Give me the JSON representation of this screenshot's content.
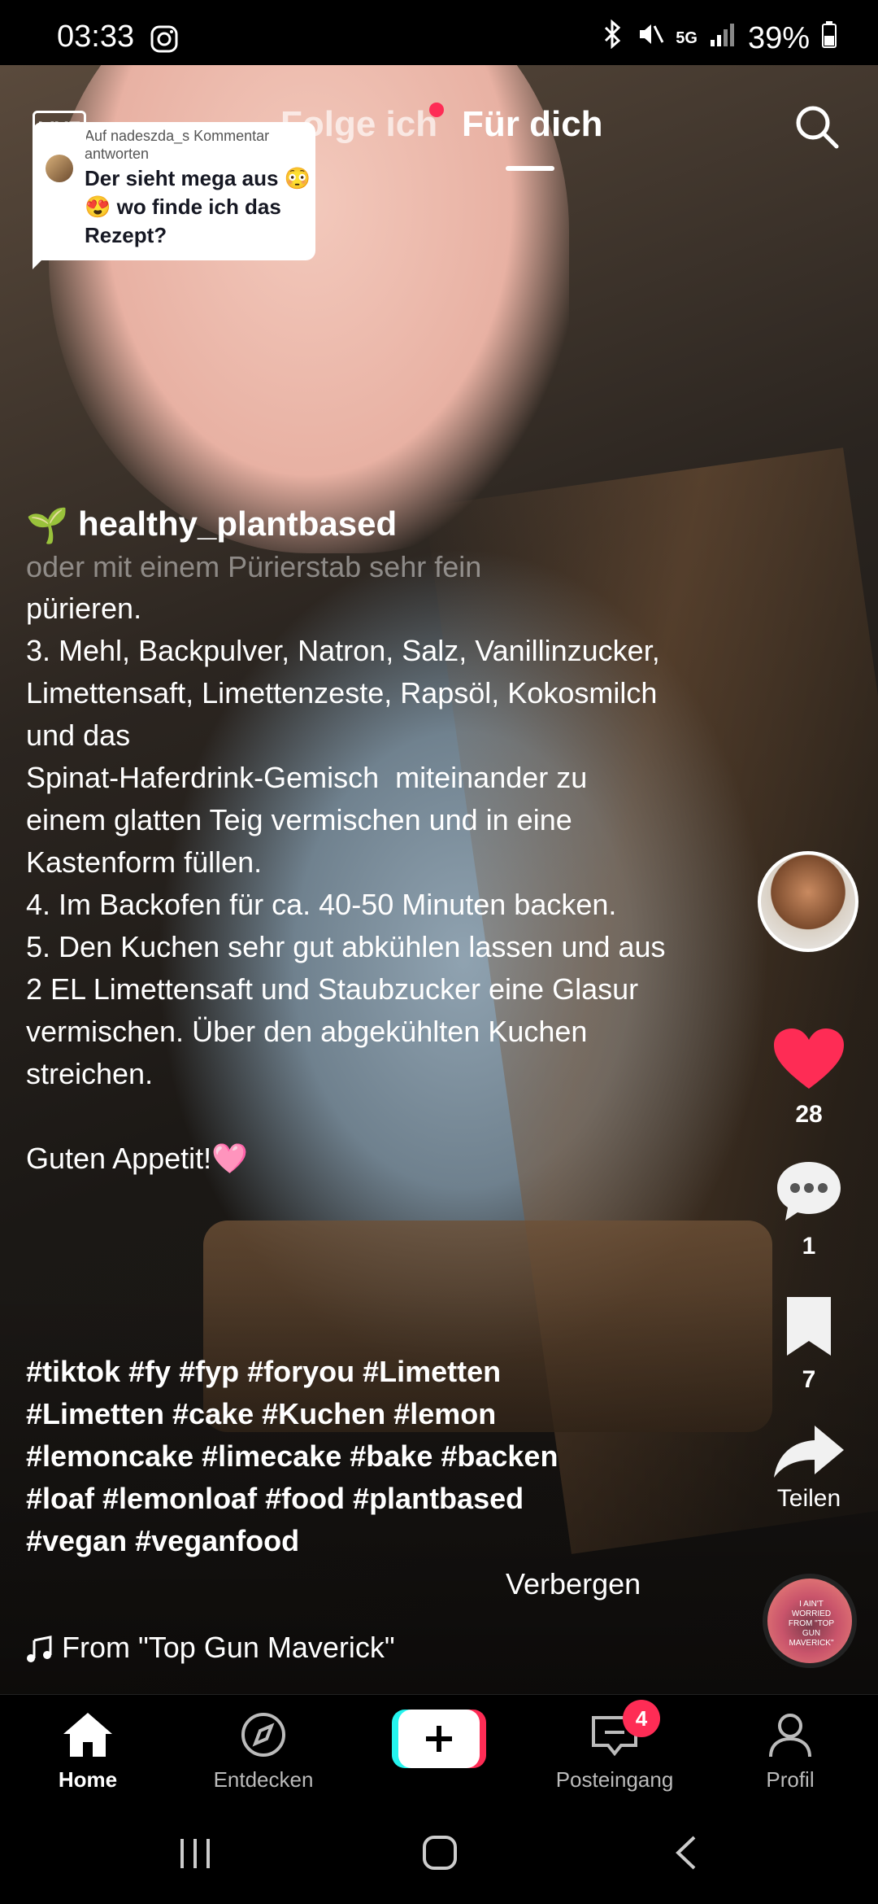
{
  "status_bar": {
    "time": "03:33",
    "network": "5G",
    "battery": "39%",
    "icons": [
      "instagram-icon",
      "bluetooth-icon",
      "mute-icon",
      "signal-icon",
      "battery-icon"
    ]
  },
  "top_nav": {
    "live_label": "LIVE",
    "tabs": [
      {
        "label": "Folge ich",
        "active": false,
        "has_dot": true
      },
      {
        "label": "Für dich",
        "active": true
      }
    ]
  },
  "reply_bubble": {
    "header": "Auf nadeszda_s Kommentar antworten",
    "text": "Der sieht mega aus 😳😍 wo finde ich das Rezept?"
  },
  "post": {
    "author": "healthy_plantbased",
    "author_emoji": "🌱",
    "caption_faded": "oder mit einem Pürierstab sehr fein",
    "caption": "pürieren.\n3. Mehl, Backpulver, Natron, Salz, Vanillinzucker,\nLimettensaft, Limettenzeste, Rapsöl, Kokosmilch und das\nSpinat-Haferdrink-Gemisch  miteinander zu einem glatten Teig vermischen und in eine Kastenform füllen.\n4. Im Backofen für ca. 40-50 Minuten backen.\n5. Den Kuchen sehr gut abkühlen lassen und aus\n2 EL Limettensaft und Staubzucker eine Glasur vermischen. Über den abgekühlten Kuchen streichen.\n\nGuten Appetit!🩷",
    "hashtags": "#tiktok #fy #fyp #foryou #Limetten\n#Limetten #cake #Kuchen #lemon\n#lemoncake #limecake #bake #backen\n#loaf #lemonloaf #food #plantbased\n#vegan #veganfood",
    "hide_label": "Verbergen",
    "music": "From \"Top Gun Maverick\""
  },
  "actions": {
    "likes": "28",
    "comments": "1",
    "saves": "7",
    "share_label": "Teilen",
    "like_color": "#fe2c55"
  },
  "disc": {
    "text": "I AIN'T WORRIED FROM \"TOP GUN MAVERICK\""
  },
  "bottom_nav": {
    "home": "Home",
    "discover": "Entdecken",
    "inbox": "Posteingang",
    "inbox_badge": "4",
    "profile": "Profil"
  }
}
